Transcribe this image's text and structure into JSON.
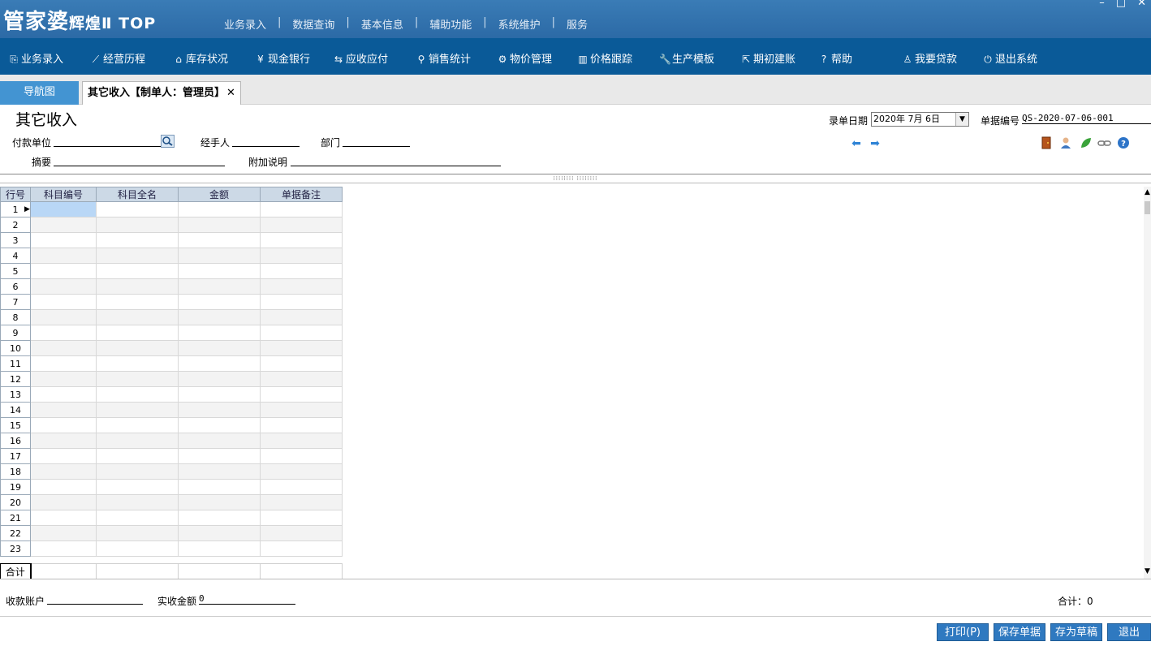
{
  "app": {
    "logo_main": "管家婆",
    "logo_sub": "辉煌Ⅱ TOP",
    "window_controls": [
      "–",
      "□",
      "✕"
    ]
  },
  "top_menu": [
    "业务录入",
    "数据查询",
    "基本信息",
    "辅助功能",
    "系统维护",
    "服务"
  ],
  "top_menu_separator": "|",
  "nav": [
    {
      "label": "业务录入",
      "icon": "document-edit-icon",
      "glyph": "⎘"
    },
    {
      "label": "经营历程",
      "icon": "line-chart-icon",
      "glyph": "⟋"
    },
    {
      "label": "库存状况",
      "icon": "home-icon",
      "glyph": "⌂"
    },
    {
      "label": "现金银行",
      "icon": "yen-icon",
      "glyph": "¥"
    },
    {
      "label": "应收应付",
      "icon": "exchange-arrows-icon",
      "glyph": "⇆"
    },
    {
      "label": "销售统计",
      "icon": "search-icon",
      "glyph": "⚲"
    },
    {
      "label": "物价管理",
      "icon": "gear-icon",
      "glyph": "⚙"
    },
    {
      "label": "价格跟踪",
      "icon": "bar-chart-icon",
      "glyph": "▥"
    },
    {
      "label": "生产模板",
      "icon": "wrench-icon",
      "glyph": "🔧"
    },
    {
      "label": "期初建账",
      "icon": "external-link-icon",
      "glyph": "⇱"
    },
    {
      "label": "帮助",
      "icon": "question-icon",
      "glyph": "?"
    },
    {
      "label": "我要贷款",
      "icon": "money-bag-icon",
      "glyph": "♙"
    },
    {
      "label": "退出系统",
      "icon": "power-icon",
      "glyph": "⏻"
    }
  ],
  "tabs": {
    "nav_tab": "导航图",
    "doc_tab": "其它收入【制单人：管理员】",
    "close_glyph": "✕"
  },
  "form": {
    "title": "其它收入",
    "payer_label": "付款单位",
    "handler_label": "经手人",
    "dept_label": "部门",
    "summary_label": "摘要",
    "note_label": "附加说明",
    "date_label": "录单日期",
    "date_value": "2020年 7月 6日",
    "doc_no_label": "单据编号",
    "doc_no_value": "QS-2020-07-06-001",
    "splitter_text": "⁞⁞⁞⁞⁞⁞⁞⁞  ⁞⁞⁞⁞⁞⁞⁞⁞"
  },
  "grid": {
    "headers": [
      "行号",
      "科目编号",
      "科目全名",
      "金额",
      "单据备注"
    ],
    "row_count": 23,
    "rows": [
      "1",
      "2",
      "3",
      "4",
      "5",
      "6",
      "7",
      "8",
      "9",
      "10",
      "11",
      "12",
      "13",
      "14",
      "15",
      "16",
      "17",
      "18",
      "19",
      "20",
      "21",
      "22",
      "23"
    ],
    "total_label": "合计"
  },
  "footer": {
    "account_label": "收款账户",
    "received_label": "实收金额",
    "received_value": "0",
    "total_label": "合计：",
    "total_value": "0"
  },
  "buttons": {
    "print": "打印(P)",
    "save": "保存单据",
    "draft": "存为草稿",
    "exit": "退出"
  },
  "colors": {
    "topbar": "#3a7cb6",
    "navbar": "#0a5a98",
    "tab_active": "#4394d2",
    "button": "#2f79c0",
    "grid_header": "#ccd9e6",
    "selected_cell": "#b9d7f6"
  }
}
